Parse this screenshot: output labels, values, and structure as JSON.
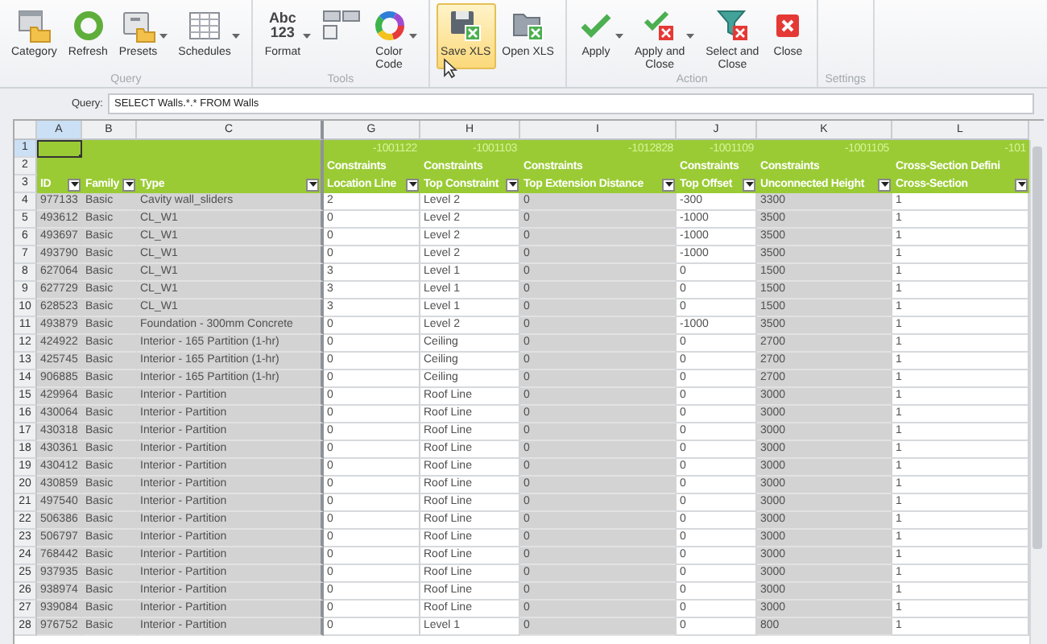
{
  "toolbar": {
    "groups": [
      {
        "label": "Query",
        "buttons": [
          {
            "label": "Category",
            "dropdown": false,
            "selected": false
          },
          {
            "label": "Refresh",
            "dropdown": false,
            "selected": false
          },
          {
            "label": "Presets",
            "dropdown": true,
            "selected": false
          },
          {
            "label": "Schedules",
            "dropdown": true,
            "selected": false
          }
        ]
      },
      {
        "label": "Tools",
        "buttons": [
          {
            "label": "Format",
            "icon_text": [
              "Abc",
              "123"
            ],
            "dropdown": true,
            "selected": false
          },
          {
            "dropdown": false,
            "selected": false
          },
          {
            "label": "Color\nCode",
            "dropdown": true,
            "selected": false
          }
        ]
      },
      {
        "buttons": [
          {
            "label": "Save XLS",
            "dropdown": false,
            "selected": true
          },
          {
            "label": "Open XLS",
            "dropdown": false,
            "selected": false
          }
        ]
      },
      {
        "label": "Action",
        "buttons": [
          {
            "label": "Apply",
            "dropdown": true,
            "selected": false
          },
          {
            "label": "Apply and\nClose",
            "dropdown": true,
            "selected": false
          },
          {
            "label": "Select and\nClose",
            "dropdown": false,
            "selected": false
          },
          {
            "label": "Close",
            "dropdown": false,
            "selected": false
          }
        ]
      },
      {
        "label": "Settings"
      }
    ]
  },
  "query": {
    "label": "Query:",
    "value": "SELECT Walls.*.* FROM Walls"
  },
  "sheet": {
    "columns": [
      {
        "letter": "A",
        "selected": true,
        "readonly": true,
        "name": "ID"
      },
      {
        "letter": "B",
        "selected": false,
        "readonly": true,
        "name": "Family"
      },
      {
        "letter": "C",
        "selected": false,
        "readonly": true,
        "name": "Type"
      },
      {
        "letter": "G",
        "selected": false,
        "readonly": false,
        "param_id": "-1001122",
        "category": "Constraints",
        "name": "Location Line"
      },
      {
        "letter": "H",
        "selected": false,
        "readonly": false,
        "param_id": "-1001103",
        "category": "Constraints",
        "name": "Top Constraint"
      },
      {
        "letter": "I",
        "selected": false,
        "readonly": true,
        "param_id": "-1012828",
        "category": "Constraints",
        "name": "Top Extension Distance"
      },
      {
        "letter": "J",
        "selected": false,
        "readonly": false,
        "param_id": "-1001109",
        "category": "Constraints",
        "name": "Top Offset"
      },
      {
        "letter": "K",
        "selected": false,
        "readonly": true,
        "param_id": "-1001105",
        "category": "Constraints",
        "name": "Unconnected Height"
      },
      {
        "letter": "L",
        "selected": false,
        "readonly": false,
        "param_id": "-101",
        "category": "Cross-Section Defini",
        "name": "Cross-Section"
      }
    ],
    "header_rows": [
      {
        "number": "1",
        "selected": true
      },
      {
        "number": "2",
        "selected": false
      },
      {
        "number": "3",
        "selected": false
      }
    ],
    "rows": [
      {
        "number": "4",
        "cells": [
          "977133",
          "Basic",
          "Cavity wall_sliders",
          "2",
          "Level 2",
          "0",
          "-300",
          "3300",
          "1"
        ]
      },
      {
        "number": "5",
        "cells": [
          "493612",
          "Basic",
          "CL_W1",
          "0",
          "Level 2",
          "0",
          "-1000",
          "3500",
          "1"
        ]
      },
      {
        "number": "6",
        "cells": [
          "493697",
          "Basic",
          "CL_W1",
          "0",
          "Level 2",
          "0",
          "-1000",
          "3500",
          "1"
        ]
      },
      {
        "number": "7",
        "cells": [
          "493790",
          "Basic",
          "CL_W1",
          "0",
          "Level 2",
          "0",
          "-1000",
          "3500",
          "1"
        ]
      },
      {
        "number": "8",
        "cells": [
          "627064",
          "Basic",
          "CL_W1",
          "3",
          "Level 1",
          "0",
          "0",
          "1500",
          "1"
        ]
      },
      {
        "number": "9",
        "cells": [
          "627729",
          "Basic",
          "CL_W1",
          "3",
          "Level 1",
          "0",
          "0",
          "1500",
          "1"
        ]
      },
      {
        "number": "10",
        "cells": [
          "628523",
          "Basic",
          "CL_W1",
          "3",
          "Level 1",
          "0",
          "0",
          "1500",
          "1"
        ]
      },
      {
        "number": "11",
        "cells": [
          "493879",
          "Basic",
          "Foundation - 300mm Concrete",
          "0",
          "Level 2",
          "0",
          "-1000",
          "3500",
          "1"
        ]
      },
      {
        "number": "12",
        "cells": [
          "424922",
          "Basic",
          "Interior - 165 Partition (1-hr)",
          "0",
          "Ceiling",
          "0",
          "0",
          "2700",
          "1"
        ]
      },
      {
        "number": "13",
        "cells": [
          "425745",
          "Basic",
          "Interior - 165 Partition (1-hr)",
          "0",
          "Ceiling",
          "0",
          "0",
          "2700",
          "1"
        ]
      },
      {
        "number": "14",
        "cells": [
          "906885",
          "Basic",
          "Interior - 165 Partition (1-hr)",
          "0",
          "Ceiling",
          "0",
          "0",
          "2700",
          "1"
        ]
      },
      {
        "number": "15",
        "cells": [
          "429964",
          "Basic",
          "Interior - Partition",
          "0",
          "Roof Line",
          "0",
          "0",
          "3000",
          "1"
        ]
      },
      {
        "number": "16",
        "cells": [
          "430064",
          "Basic",
          "Interior - Partition",
          "0",
          "Roof Line",
          "0",
          "0",
          "3000",
          "1"
        ]
      },
      {
        "number": "17",
        "cells": [
          "430318",
          "Basic",
          "Interior - Partition",
          "0",
          "Roof Line",
          "0",
          "0",
          "3000",
          "1"
        ]
      },
      {
        "number": "18",
        "cells": [
          "430361",
          "Basic",
          "Interior - Partition",
          "0",
          "Roof Line",
          "0",
          "0",
          "3000",
          "1"
        ]
      },
      {
        "number": "19",
        "cells": [
          "430412",
          "Basic",
          "Interior - Partition",
          "0",
          "Roof Line",
          "0",
          "0",
          "3000",
          "1"
        ]
      },
      {
        "number": "20",
        "cells": [
          "430859",
          "Basic",
          "Interior - Partition",
          "0",
          "Roof Line",
          "0",
          "0",
          "3000",
          "1"
        ]
      },
      {
        "number": "21",
        "cells": [
          "497540",
          "Basic",
          "Interior - Partition",
          "0",
          "Roof Line",
          "0",
          "0",
          "3000",
          "1"
        ]
      },
      {
        "number": "22",
        "cells": [
          "506386",
          "Basic",
          "Interior - Partition",
          "0",
          "Roof Line",
          "0",
          "0",
          "3000",
          "1"
        ]
      },
      {
        "number": "23",
        "cells": [
          "506797",
          "Basic",
          "Interior - Partition",
          "0",
          "Roof Line",
          "0",
          "0",
          "3000",
          "1"
        ]
      },
      {
        "number": "24",
        "cells": [
          "768442",
          "Basic",
          "Interior - Partition",
          "0",
          "Roof Line",
          "0",
          "0",
          "3000",
          "1"
        ]
      },
      {
        "number": "25",
        "cells": [
          "937935",
          "Basic",
          "Interior - Partition",
          "0",
          "Roof Line",
          "0",
          "0",
          "3000",
          "1"
        ]
      },
      {
        "number": "26",
        "cells": [
          "938974",
          "Basic",
          "Interior - Partition",
          "0",
          "Roof Line",
          "0",
          "0",
          "3000",
          "1"
        ]
      },
      {
        "number": "27",
        "cells": [
          "939084",
          "Basic",
          "Interior - Partition",
          "0",
          "Roof Line",
          "0",
          "0",
          "3000",
          "1"
        ]
      },
      {
        "number": "28",
        "cells": [
          "976752",
          "Basic",
          "Interior - Partition",
          "0",
          "Level 1",
          "0",
          "0",
          "800",
          "1"
        ]
      }
    ]
  }
}
